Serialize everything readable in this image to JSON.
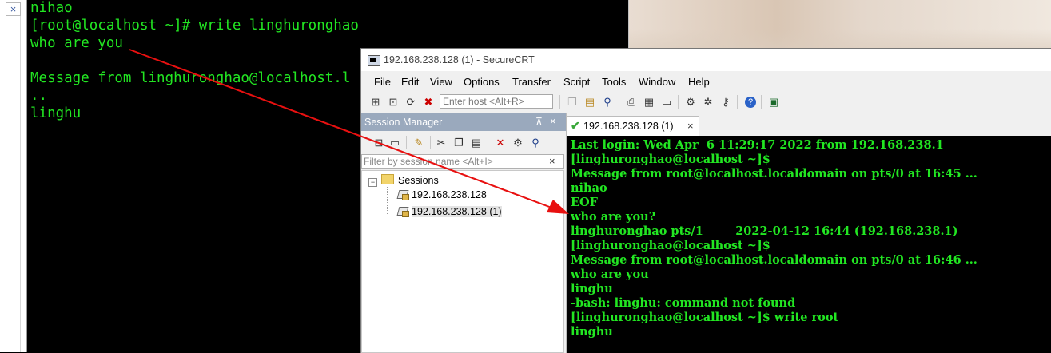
{
  "left_terminal": {
    "close_glyph": "×",
    "lines": [
      "nihao",
      "[root@localhost ~]# write linghuronghao",
      "who are you",
      "",
      "Message from linghuronghao@localhost.l",
      "..",
      "linghu"
    ]
  },
  "window": {
    "title": "192.168.238.128 (1) - SecureCRT"
  },
  "menu": [
    "File",
    "Edit",
    "View",
    "Options",
    "Transfer",
    "Script",
    "Tools",
    "Window",
    "Help"
  ],
  "toolbar": {
    "host_placeholder": "Enter host <Alt+R>"
  },
  "session_manager": {
    "title": "Session Manager",
    "pin_glyph": "⊼",
    "close_glyph": "×",
    "filter_placeholder": "Filter by session name <Alt+I>",
    "filter_clear": "×",
    "expander_glyph": "−",
    "root": "Sessions",
    "items": [
      "192.168.238.128",
      "192.168.238.128 (1)"
    ]
  },
  "tab": {
    "label": "192.168.238.128 (1)",
    "check_glyph": "✔",
    "close_glyph": "×"
  },
  "crt_terminal": {
    "lines": [
      "Last login: Wed Apr  6 11:29:17 2022 from 192.168.238.1",
      "[linghuronghao@localhost ~]$",
      "Message from root@localhost.localdomain on pts/0 at 16:45 ...",
      "nihao",
      "EOF",
      "who are you?",
      "linghuronghao pts/1        2022-04-12 16:44 (192.168.238.1)",
      "[linghuronghao@localhost ~]$",
      "Message from root@localhost.localdomain on pts/0 at 16:46 ...",
      "who are you",
      "linghu",
      "-bash: linghu: command not found",
      "[linghuronghao@localhost ~]$ write root",
      "linghu"
    ]
  },
  "colors": {
    "terminal_text": "#22e622",
    "terminal_bg": "#000000",
    "arrow": "#e81010",
    "session_header": "#9aa9bd"
  }
}
